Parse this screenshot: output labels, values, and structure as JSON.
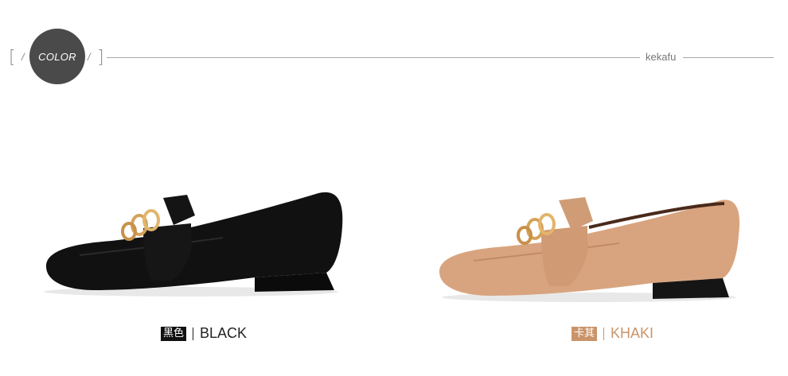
{
  "header": {
    "left_bracket": "[",
    "right_bracket": "]",
    "slash_left": "/",
    "slash_right": "/",
    "badge_label": "COLOR",
    "brand": "kekafu"
  },
  "products": [
    {
      "tag": "黑色",
      "label": "BLACK",
      "color": "#111111",
      "tag_bg": "#111111",
      "text_color": "#222222"
    },
    {
      "tag": "卡其",
      "label": "KHAKI",
      "color": "#d8a47f",
      "tag_bg": "#c9946a",
      "text_color": "#c9946a"
    }
  ]
}
